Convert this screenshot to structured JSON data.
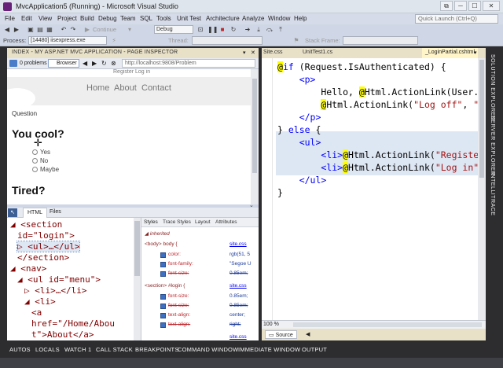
{
  "window": {
    "title": "MvcApplication5 (Running) - Microsoft Visual Studio",
    "buttons": [
      "⧉",
      "─",
      "☐",
      "✕"
    ]
  },
  "menu": [
    "File",
    "Edit",
    "View",
    "Project",
    "Build",
    "Debug",
    "Team",
    "SQL",
    "Tools",
    "Unit Test",
    "Architecture",
    "Analyze",
    "Window",
    "Help"
  ],
  "quick_launch_placeholder": "Quick Launch (Ctrl+Q)",
  "toolbar": {
    "continue_label": "Continue",
    "config_combo": "Debug",
    "process_label": "Process:",
    "process_value": "[14480] iisexpress.exe",
    "thread_label": "Thread:",
    "stack_frame_label": "Stack Frame:"
  },
  "inspector": {
    "header": "INDEX - MY ASP.NET MVC APPLICATION - PAGE INSPECTOR",
    "problems": "0 problems",
    "browser_tab": "Browser",
    "url": "http://localhost:9808/Problem",
    "page": {
      "top_links": "Register  Log in",
      "nav": [
        "Home",
        "About",
        "Contact"
      ],
      "question_label": "Question",
      "question1": "You cool?",
      "options": [
        "Yes",
        "No",
        "Maybe"
      ],
      "question2": "Tired?"
    },
    "dom_tabs": [
      "HTML",
      "Files"
    ],
    "dom_lines": [
      {
        "indent": 0,
        "text": "◢ <section"
      },
      {
        "indent": 1,
        "text": "id=\"login\">"
      },
      {
        "indent": 1,
        "text": "▷ <ul>…</ul>"
      },
      {
        "indent": 1,
        "text": "</section>"
      },
      {
        "indent": 0,
        "text": "◢ <nav>"
      },
      {
        "indent": 1,
        "text": "◢ <ul id=\"menu\">"
      },
      {
        "indent": 2,
        "text": "▷ <li>…</li>"
      },
      {
        "indent": 2,
        "text": "◢ <li>"
      },
      {
        "indent": 3,
        "text": "<a"
      },
      {
        "indent": 3,
        "text": "href=\"/Home/Abou"
      },
      {
        "indent": 3,
        "text": "t\">About</a>"
      }
    ],
    "style_tabs": [
      "Styles",
      "Trace Styles",
      "Layout",
      "Attributes"
    ],
    "styles": {
      "inherited": "inherited",
      "rule1": {
        "selector": "<body> body {",
        "source": "site.css",
        "props": [
          {
            "name": "color:",
            "value": "rgb(51, 5",
            "struck": false
          },
          {
            "name": "font-family:",
            "value": "\"Segoe U",
            "struck": false
          },
          {
            "name": "font-size:",
            "value": "0.85em;",
            "struck": true
          }
        ]
      },
      "rule2": {
        "selector": "<section> #login {",
        "source": "site.css",
        "props": [
          {
            "name": "font-size:",
            "value": "0.85em;",
            "struck": false
          },
          {
            "name": "font-size:",
            "value": "0.85em;",
            "struck": true
          },
          {
            "name": "text-align:",
            "value": "center;",
            "struck": false
          },
          {
            "name": "text-align:",
            "value": "right;",
            "struck": true
          }
        ]
      },
      "rule3": {
        "source": "site.css"
      }
    }
  },
  "editor": {
    "tabs": [
      "Site.css",
      "UnitTest1.cs",
      "_LoginPartial.cshtml"
    ],
    "code": [
      {
        "parts": [
          [
            "razor",
            "@"
          ],
          [
            "kw",
            "if"
          ],
          [
            "plain",
            " (Request.IsAuthenticated) {"
          ]
        ]
      },
      {
        "parts": [
          [
            "plain",
            "    "
          ],
          [
            "kw",
            "<p>"
          ]
        ]
      },
      {
        "parts": [
          [
            "plain",
            "        Hello, "
          ],
          [
            "razor",
            "@"
          ],
          [
            "plain",
            "Html.ActionLink(User.Ide"
          ]
        ]
      },
      {
        "parts": [
          [
            "plain",
            "        "
          ],
          [
            "razor",
            "@"
          ],
          [
            "plain",
            "Html.ActionLink("
          ],
          [
            "str",
            "\"Log off\""
          ],
          [
            "plain",
            ", "
          ],
          [
            "str",
            "\"Log"
          ]
        ]
      },
      {
        "parts": [
          [
            "plain",
            "    "
          ],
          [
            "kw",
            "</p>"
          ]
        ]
      },
      {
        "parts": [
          [
            "plain",
            "} "
          ],
          [
            "kw",
            "else"
          ],
          [
            "plain",
            " {"
          ]
        ]
      },
      {
        "parts": [
          [
            "plain",
            "    "
          ],
          [
            "kw",
            "<ul>"
          ]
        ]
      },
      {
        "parts": [
          [
            "plain",
            "        "
          ],
          [
            "kw",
            "<li>"
          ],
          [
            "razor",
            "@"
          ],
          [
            "plain",
            "Html.ActionLink("
          ],
          [
            "str",
            "\"Register\""
          ],
          [
            "plain",
            ", "
          ]
        ]
      },
      {
        "parts": [
          [
            "plain",
            "        "
          ],
          [
            "kw",
            "<li>"
          ],
          [
            "razor",
            "@"
          ],
          [
            "plain",
            "Html.ActionLink("
          ],
          [
            "str",
            "\"Log in\""
          ],
          [
            "plain",
            ", "
          ],
          [
            "str",
            "\""
          ]
        ]
      },
      {
        "parts": [
          [
            "plain",
            "    "
          ],
          [
            "kw",
            "</ul>"
          ]
        ]
      },
      {
        "parts": [
          [
            "plain",
            "}"
          ]
        ]
      }
    ],
    "zoom": "100 %",
    "view_source": "Source"
  },
  "right_tabs": [
    "SOLUTION EXPLORER",
    "SERVER EXPLORER",
    "INTELLITRACE"
  ],
  "bottom_tabs": [
    "AUTOS",
    "LOCALS",
    "WATCH 1",
    "CALL STACK",
    "BREAKPOINTS",
    "COMMAND WINDOW",
    "IMMEDIATE WINDOW",
    "OUTPUT"
  ],
  "colors": {
    "accent": "#68217a",
    "chrome": "#2d2d30",
    "razor_highlight": "#ffff00",
    "keyword": "#0000ff",
    "string": "#a31515"
  }
}
